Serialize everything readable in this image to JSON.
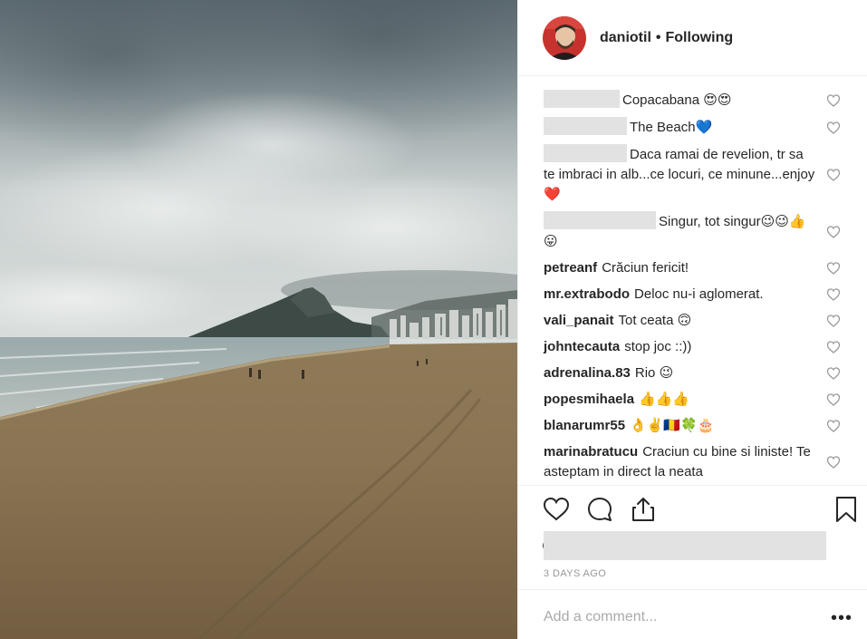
{
  "post": {
    "photo_label": "beach-photo",
    "header": {
      "username": "daniotil",
      "separator": "•",
      "follow_status": "Following"
    },
    "comments": [
      {
        "user": "",
        "text": "Copacabana 😍😍",
        "redacted_user": true
      },
      {
        "user": "",
        "text": "The Beach💙",
        "redacted_user": true
      },
      {
        "user": "",
        "text": "Daca ramai de revelion, tr sa te imbraci in alb...ce locuri, ce minune...enjoy❤️",
        "redacted_user": true
      },
      {
        "user": "",
        "text": "Singur, tot singur😉😉👍😛",
        "redacted_user": true
      },
      {
        "user": "petreanf",
        "text": "Crăciun fericit!"
      },
      {
        "user": "mr.extrabodo",
        "text": "Deloc nu-i aglomerat."
      },
      {
        "user": "vali_panait",
        "text": "Tot ceata 🙃"
      },
      {
        "user": "johntecauta",
        "text": "stop joc ::))"
      },
      {
        "user": "adrenalina.83",
        "text": "Rio 😉"
      },
      {
        "user": "popesmihaela",
        "text": "👍👍👍"
      },
      {
        "user": "blanarumr55",
        "text": "👌✌️🇷🇴🍀🎂"
      },
      {
        "user": "marinabratucu",
        "text": "Craciun cu bine si liniste! Te asteptam in direct la neata"
      }
    ],
    "time_ago": "3 DAYS AGO",
    "add_comment_placeholder": "Add a comment...",
    "more_options": "•••"
  },
  "colors": {
    "text": "#262626",
    "muted": "#999999",
    "border": "#efefef",
    "redaction": "#e2e2e2"
  }
}
